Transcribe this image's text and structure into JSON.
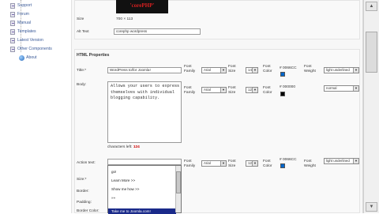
{
  "sidebar": {
    "items": [
      {
        "label": "Support"
      },
      {
        "label": "Forum"
      },
      {
        "label": "Manual"
      },
      {
        "label": "Templates"
      },
      {
        "label": "Latest Version"
      },
      {
        "label": "Other Components"
      },
      {
        "label": "About"
      }
    ]
  },
  "image_section": {
    "logo_text": "'corePHP'",
    "size_label": "Size",
    "size_value": "700 × 113",
    "alt_label": "Alt Text",
    "alt_value": "corephp wordpress"
  },
  "html_properties": {
    "heading": "HTML Properties",
    "title_label": "Title:*",
    "title_value": "WordPress to/for Joomla!",
    "body_label": "Body:",
    "body_value": "Allows your users to express\nthemselves with individual\nblogging capability.",
    "chars_left_label": "characters left:",
    "chars_left_value": "124",
    "action_text_label": "Action text:",
    "size_label": "Size:*",
    "border_label": "Border:",
    "padding_label": "Padding:",
    "border_color_label": "Border Color:",
    "font_family_label": "Font Family",
    "font_size_label": "Font Size",
    "font_color_label": "Font Color",
    "font_weight_label": "Font Weight",
    "rows": [
      {
        "family": "Arial",
        "size": "14",
        "color_hex": "# 0066CC",
        "swatch": "#0066cc",
        "weight": "light underlined"
      },
      {
        "family": "Arial",
        "size": "12",
        "color_hex": "# 000000",
        "swatch": "#000000",
        "weight": "normal"
      },
      {
        "family": "Arial",
        "size": "12",
        "color_hex": "# 0066CC",
        "swatch": "#0066cc",
        "weight": "light underlined"
      }
    ]
  },
  "dropdown": {
    "options": [
      "go!",
      "Learn More >>",
      "Show me how >>",
      "»»",
      "Take me to Joomla.com!"
    ],
    "selected_index": 4
  }
}
